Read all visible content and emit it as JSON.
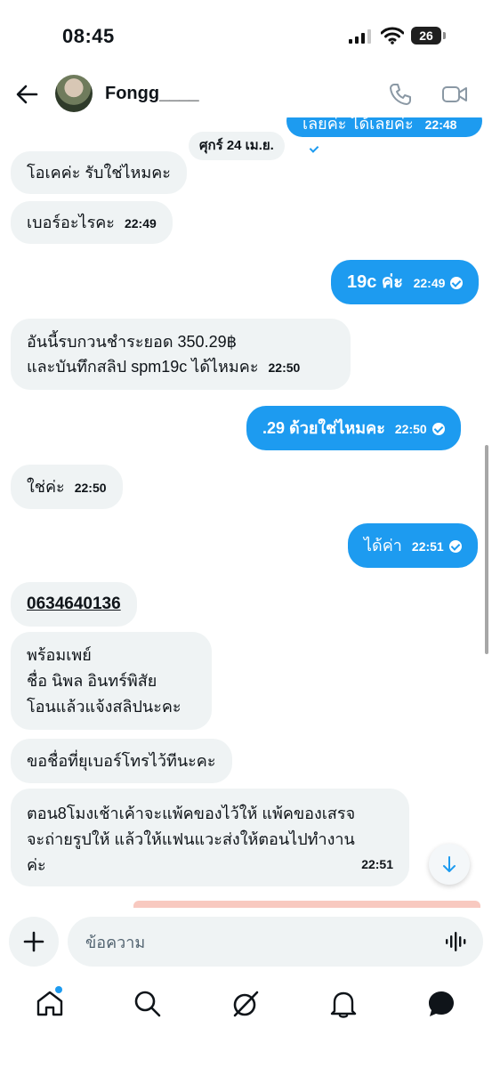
{
  "status_bar": {
    "time": "08:45",
    "battery": "26"
  },
  "header": {
    "contact_name": "Fongg____"
  },
  "chat": {
    "date_separator": "ศุกร์ 24 เม.ย.",
    "top_partial": {
      "text": "เลยค่ะ ได้เลยค่ะ",
      "time": "22:48"
    },
    "messages": [
      {
        "lines": [
          "โอเคค่ะ รับใช่ไหมคะ"
        ],
        "time": ""
      },
      {
        "lines": [
          "เบอร์อะไรคะ"
        ],
        "time": "22:49"
      },
      {
        "lines": [
          "19c ค่ะ"
        ],
        "time": "22:49"
      },
      {
        "lines": [
          "อันนี้รบกวนชำระยอด 350.29฿",
          "และบันทึกสลิป spm19c ได้ไหมคะ"
        ],
        "time": "22:50"
      },
      {
        "lines": [
          ".29 ด้วยใช่ไหมคะ"
        ],
        "time": "22:50"
      },
      {
        "lines": [
          "ใช่ค่ะ"
        ],
        "time": "22:50"
      },
      {
        "lines": [
          "ได้ค่า"
        ],
        "time": "22:51"
      },
      {
        "lines": [
          "0634640136"
        ],
        "time": ""
      },
      {
        "lines": [
          "พร้อมเพย์",
          "ชื่อ นิพล อินทร์พิสัย",
          "โอนแล้วแจ้งสลิปนะคะ"
        ],
        "time": ""
      },
      {
        "lines": [
          "ขอชื่อที่ยุเบอร์โทรไว้ทีนะคะ"
        ],
        "time": ""
      },
      {
        "lines": [
          "ตอน8โมงเช้าเค้าจะแพ้คของไว้ให้ แพ้คของเสรจ",
          "จะถ่ายรูปให้ แล้วให้แฟนแวะส่งให้ตอนไปทำงาน",
          "ค่ะ"
        ],
        "time": "22:51"
      }
    ]
  },
  "compose": {
    "placeholder": "ข้อความ"
  },
  "tabbar": {
    "items": [
      "home",
      "search",
      "grok",
      "notifications",
      "messages"
    ]
  },
  "icons": {
    "back": "arrow-left-icon",
    "call": "phone-icon",
    "video": "video-camera-icon",
    "add": "plus-icon",
    "voice": "voice-wave-icon",
    "scroll_down": "arrow-down-icon",
    "home": "home-icon",
    "search": "search-icon",
    "grok": "grok-icon",
    "notifications": "bell-icon",
    "messages": "message-bubble-icon"
  },
  "colors": {
    "outgoing_bubble": "#1d9bf0",
    "incoming_bubble": "#eff3f4",
    "accent": "#1d9bf0"
  }
}
